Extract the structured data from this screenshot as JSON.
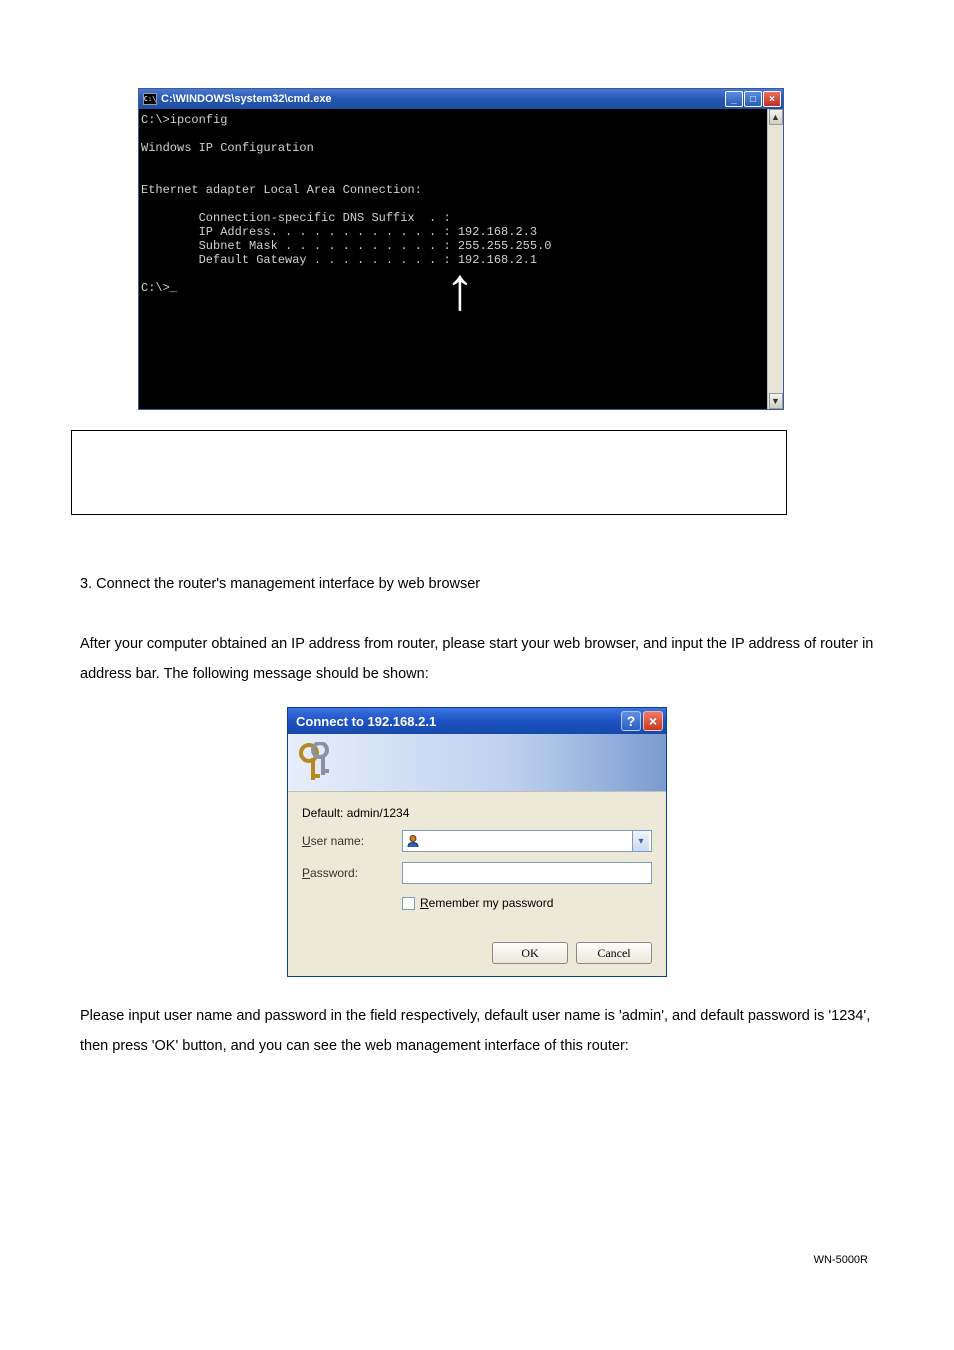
{
  "cmd": {
    "title": "C:\\WINDOWS\\system32\\cmd.exe",
    "icon_text": "C:\\",
    "min": "_",
    "max": "□",
    "close": "×",
    "lines": "C:\\>ipconfig\n\nWindows IP Configuration\n\n\nEthernet adapter Local Area Connection:\n\n        Connection-specific DNS Suffix  . :\n        IP Address. . . . . . . . . . . . : 192.168.2.3\n        Subnet Mask . . . . . . . . . . . : 255.255.255.0\n        Default Gateway . . . . . . . . . : 192.168.2.1\n\nC:\\>_",
    "scroll_up": "▲",
    "scroll_down": "▼",
    "arrow": "↑"
  },
  "step3_heading": "3. Connect the router's management interface by web browser",
  "step3_para": "After your computer obtained an IP address from router, please start your web browser, and input the IP address of router in address bar. The following message should be shown:",
  "dlg": {
    "title": "Connect to 192.168.2.1",
    "help": "?",
    "close": "×",
    "default_text": "Default: admin/1234",
    "username_u": "U",
    "username_rest": "ser name:",
    "password_u": "P",
    "password_rest": "assword:",
    "remember_u": "R",
    "remember_rest": "emember my password",
    "dd": "▾",
    "ok": "OK",
    "cancel": "Cancel"
  },
  "closing_para": "Please input user name and password in the field respectively, default user name is 'admin', and default password is '1234', then press 'OK' button, and you can see the web management interface of this router:",
  "footer": "WN-5000R"
}
